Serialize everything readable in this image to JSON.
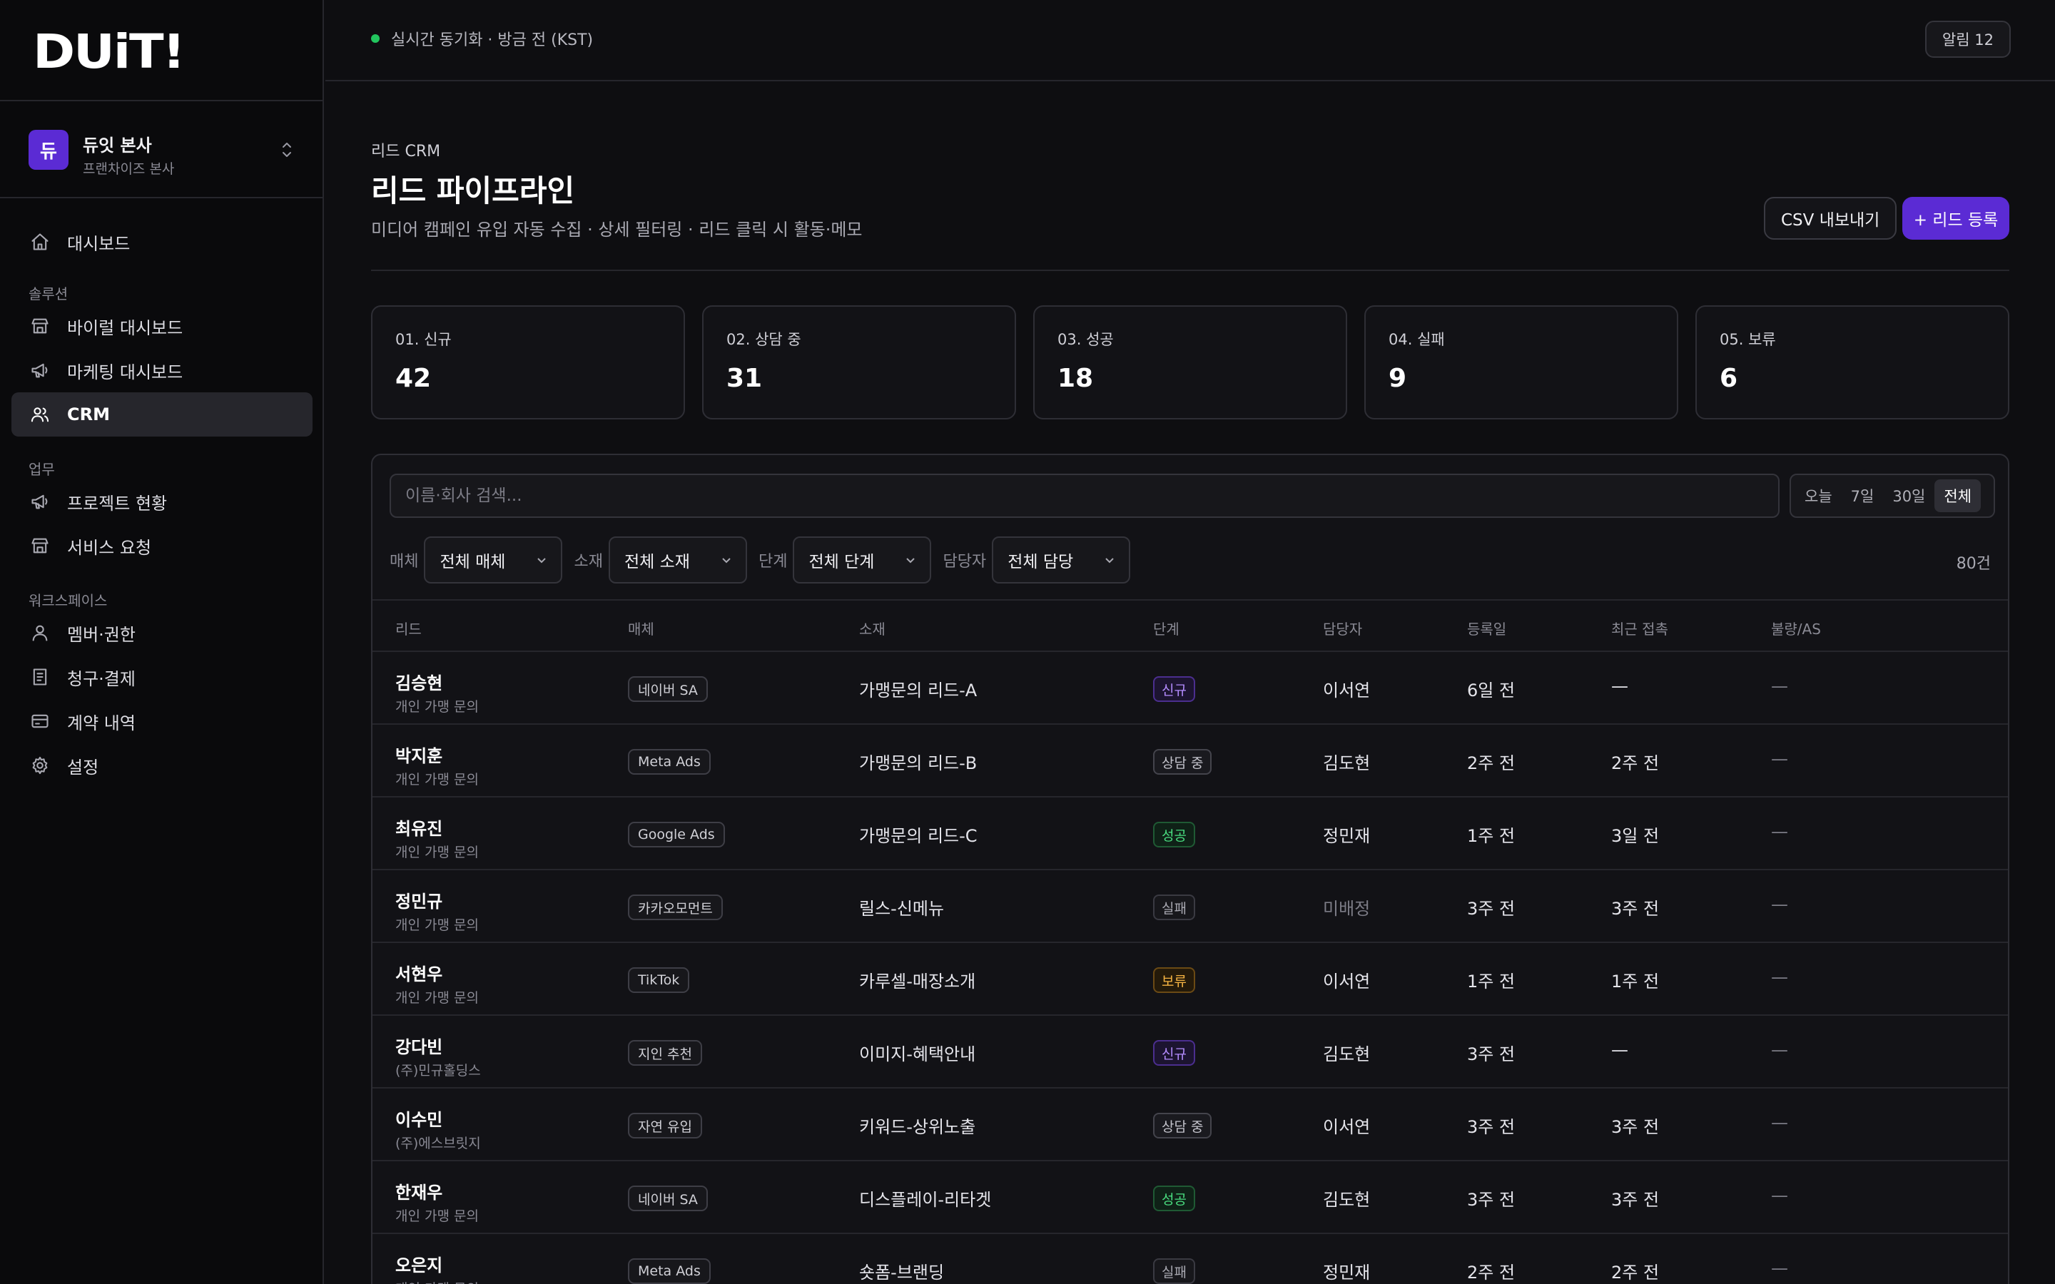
{
  "brand": {
    "logo": "DUiT!"
  },
  "org": {
    "avatar": "듀",
    "name": "듀잇 본사",
    "sub": "프랜차이즈 본사"
  },
  "nav": {
    "dashboard": "대시보드",
    "section_solution": "솔루션",
    "viral": "바이럴 대시보드",
    "marketing": "마케팅 대시보드",
    "crm": "CRM",
    "section_work": "업무",
    "projects": "프로젝트 현황",
    "requests": "서비스 요청",
    "section_workspace": "워크스페이스",
    "members": "멤버·권한",
    "billing": "청구·결제",
    "contracts": "계약 내역",
    "settings": "설정"
  },
  "topbar": {
    "sync": "실시간 동기화 · 방금 전 (KST)",
    "notif": "알림 12"
  },
  "header": {
    "eyebrow": "리드 CRM",
    "title": "리드 파이프라인",
    "desc": "미디어 캠페인 유입 자동 수집 · 상세 필터링 · 리드 클릭 시 활동·메모",
    "export": "CSV 내보내기",
    "add": "+ 리드 등록"
  },
  "stats": [
    {
      "label": "01. 신규",
      "value": "42"
    },
    {
      "label": "02. 상담 중",
      "value": "31"
    },
    {
      "label": "03. 성공",
      "value": "18"
    },
    {
      "label": "04. 실패",
      "value": "9"
    },
    {
      "label": "05. 보류",
      "value": "6"
    }
  ],
  "search": {
    "placeholder": "이름·회사 검색..."
  },
  "ranges": [
    "오늘",
    "7일",
    "30일",
    "전체"
  ],
  "filters": {
    "media_label": "매체",
    "media_value": "전체 매체",
    "creative_label": "소재",
    "creative_value": "전체 소재",
    "stage_label": "단계",
    "stage_value": "전체 단계",
    "owner_label": "담당자",
    "owner_value": "전체 담당",
    "count": "80건"
  },
  "table": {
    "headers": [
      "리드",
      "매체",
      "소재",
      "단계",
      "담당자",
      "등록일",
      "최근 접촉",
      "불량/AS"
    ],
    "rows": [
      {
        "name": "김승현",
        "sub": "개인 가맹 문의",
        "media": "네이버 SA",
        "creative": "가맹문의 리드-A",
        "stage": "신규",
        "owner": "이서연",
        "reg": "6일 전",
        "last": "—",
        "as": "—"
      },
      {
        "name": "박지훈",
        "sub": "개인 가맹 문의",
        "media": "Meta Ads",
        "creative": "가맹문의 리드-B",
        "stage": "상담 중",
        "owner": "김도현",
        "reg": "2주 전",
        "last": "2주 전",
        "as": "—"
      },
      {
        "name": "최유진",
        "sub": "개인 가맹 문의",
        "media": "Google Ads",
        "creative": "가맹문의 리드-C",
        "stage": "성공",
        "owner": "정민재",
        "reg": "1주 전",
        "last": "3일 전",
        "as": "—"
      },
      {
        "name": "정민규",
        "sub": "개인 가맹 문의",
        "media": "카카오모먼트",
        "creative": "릴스-신메뉴",
        "stage": "실패",
        "owner": "미배정",
        "reg": "3주 전",
        "last": "3주 전",
        "as": "—"
      },
      {
        "name": "서현우",
        "sub": "개인 가맹 문의",
        "media": "TikTok",
        "creative": "카루셀-매장소개",
        "stage": "보류",
        "owner": "이서연",
        "reg": "1주 전",
        "last": "1주 전",
        "as": "—"
      },
      {
        "name": "강다빈",
        "sub": "(주)민규홀딩스",
        "media": "지인 추천",
        "creative": "이미지-혜택안내",
        "stage": "신규",
        "owner": "김도현",
        "reg": "3주 전",
        "last": "—",
        "as": "—"
      },
      {
        "name": "이수민",
        "sub": "(주)에스브릿지",
        "media": "자연 유입",
        "creative": "키워드-상위노출",
        "stage": "상담 중",
        "owner": "이서연",
        "reg": "3주 전",
        "last": "3주 전",
        "as": "—"
      },
      {
        "name": "한재우",
        "sub": "개인 가맹 문의",
        "media": "네이버 SA",
        "creative": "디스플레이-리타겟",
        "stage": "성공",
        "owner": "김도현",
        "reg": "3주 전",
        "last": "3주 전",
        "as": "—"
      },
      {
        "name": "오은지",
        "sub": "개인 가맹 문의",
        "media": "Meta Ads",
        "creative": "숏폼-브랜딩",
        "stage": "실패",
        "owner": "정민재",
        "reg": "2주 전",
        "last": "2주 전",
        "as": "—"
      }
    ]
  }
}
